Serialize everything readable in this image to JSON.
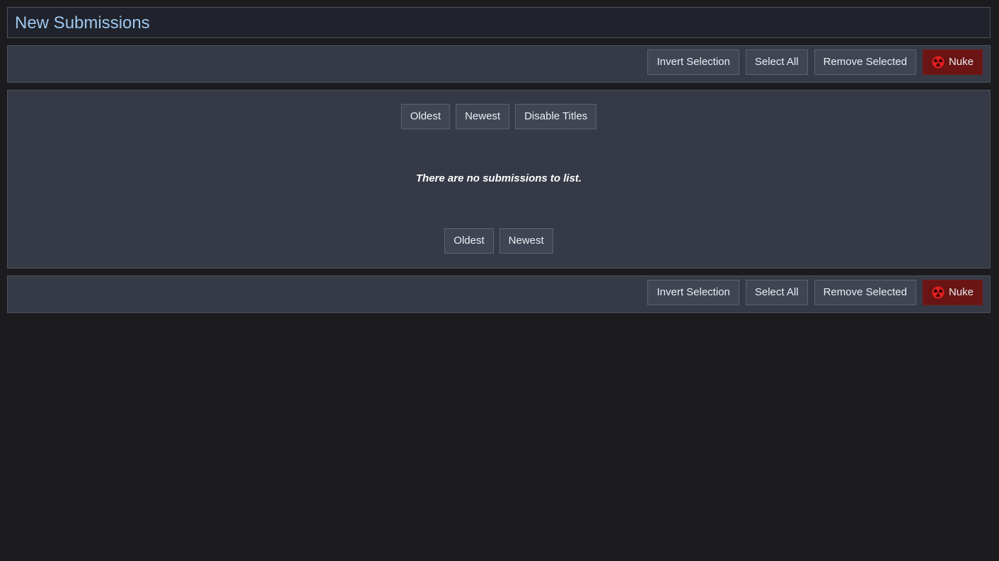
{
  "header": {
    "title": "New Submissions"
  },
  "toolbar_top": {
    "invert_label": "Invert Selection",
    "select_all_label": "Select All",
    "remove_label": "Remove Selected",
    "nuke_label": "Nuke"
  },
  "list": {
    "sort_top": {
      "oldest_label": "Oldest",
      "newest_label": "Newest",
      "disable_titles_label": "Disable Titles"
    },
    "empty_message": "There are no submissions to list.",
    "sort_bottom": {
      "oldest_label": "Oldest",
      "newest_label": "Newest"
    }
  },
  "toolbar_bottom": {
    "invert_label": "Invert Selection",
    "select_all_label": "Select All",
    "remove_label": "Remove Selected",
    "nuke_label": "Nuke"
  },
  "icons": {
    "nuke": "radiation-icon"
  },
  "colors": {
    "title": "#9ec7ee",
    "panel_bg": "#353a46",
    "nuke_bg": "#6a1414",
    "nuke_icon": "#e21f1f",
    "page_bg": "#1c1c1e"
  }
}
